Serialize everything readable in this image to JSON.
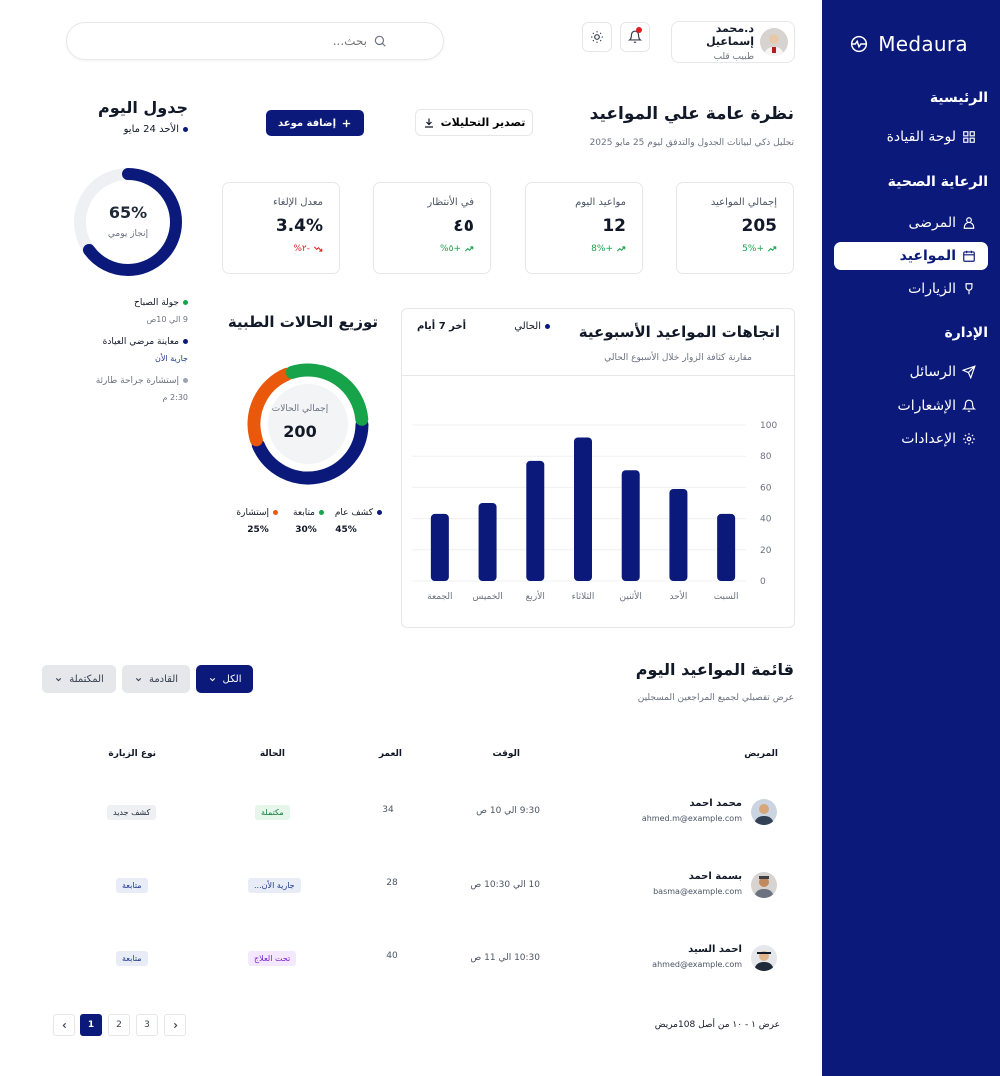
{
  "brand": {
    "name": "Medaura"
  },
  "sidebar": {
    "sections": [
      {
        "title": "الرئيسية",
        "items": [
          {
            "label": "لوحة القيادة",
            "icon": "dashboard-icon"
          }
        ]
      },
      {
        "title": "الرعاية الصحية",
        "items": [
          {
            "label": "المرضى",
            "icon": "patients-icon"
          },
          {
            "label": "المواعيد",
            "icon": "calendar-icon",
            "active": true
          },
          {
            "label": "الزيارات",
            "icon": "visits-icon"
          }
        ]
      },
      {
        "title": "الإدارة",
        "items": [
          {
            "label": "الرسائل",
            "icon": "send-icon"
          },
          {
            "label": "الإشعارات",
            "icon": "bell-icon"
          },
          {
            "label": "الإعدادات",
            "icon": "gear-icon"
          }
        ]
      }
    ]
  },
  "header": {
    "search_placeholder": "بحث...",
    "user_name": "د.محمد إسماعيل",
    "user_role": "طبيب قلب"
  },
  "overview": {
    "title": "نظرة عامة علي المواعيد",
    "subtitle": "تحليل ذكي لبيانات الجدول والتدفق ليوم 25 مايو 2025",
    "export_label": "تصدير التحليلات",
    "add_label": "إضافة موعد"
  },
  "stats": [
    {
      "label": "إجمالي المواعيد",
      "value": "205",
      "change": "+5%",
      "trend": "up"
    },
    {
      "label": "مواعيد اليوم",
      "value": "12",
      "change": "+8%",
      "trend": "up"
    },
    {
      "label": "في الأنتظار",
      "value": "٤٥",
      "change": "+٥%",
      "trend": "up"
    },
    {
      "label": "معدل الإلغاء",
      "value": "3.4%",
      "change": "-٢%",
      "trend": "down"
    }
  ],
  "schedule": {
    "title": "جدول اليوم",
    "date": "الأحد 24 مايو",
    "progress_value": "65%",
    "progress_fraction": 0.65,
    "progress_label": "إنجاز يومي",
    "items": [
      {
        "title": "جولة الصباح",
        "time": "9 الي 10ص",
        "color": "#16a34a"
      },
      {
        "title": "معاينة مرضي العيادة",
        "time": "جارية الأن",
        "color": "#0b1a7a"
      },
      {
        "title": "إستشارة جراحة طارئة",
        "time": "2:30 م",
        "color": "#9ca3af"
      }
    ]
  },
  "distribution": {
    "title": "توزيع الحالات الطبية",
    "center_label": "إجمالي الحالات",
    "center_value": "200",
    "segments": [
      {
        "label": "كشف عام",
        "percent": "45%",
        "value": 45,
        "color": "#0b1a7a"
      },
      {
        "label": "متابعة",
        "percent": "30%",
        "value": 30,
        "color": "#16a34a"
      },
      {
        "label": "إستشارة",
        "percent": "25%",
        "value": 25,
        "color": "#ea580c"
      }
    ]
  },
  "chart_data": {
    "type": "bar",
    "title": "اتجاهات المواعيد الأسبوعية",
    "subtitle": "مقارنة كثافة الزوار خلال الأسبوع الحالي",
    "legend_current": "الحالي",
    "period": "أخر 7 أيام",
    "categories": [
      "السبت",
      "الأحد",
      "الأثنين",
      "الثلاثاء",
      "الأربع",
      "الخميس",
      "الجمعة"
    ],
    "values": [
      43,
      59,
      71,
      92,
      77,
      50,
      43
    ],
    "yticks": [
      "0",
      "20",
      "40",
      "60",
      "80",
      "100"
    ],
    "ylim": [
      0,
      100
    ],
    "color": "#0b1a7a"
  },
  "appointments": {
    "title": "قائمة المواعيد اليوم",
    "subtitle": "عرض تفصيلي لجميع المراجعين المسجلين",
    "filters": [
      {
        "label": "الكل",
        "active": true
      },
      {
        "label": "القادمة"
      },
      {
        "label": "المكتملة"
      }
    ],
    "columns": {
      "patient": "المريض",
      "time": "الوقت",
      "age": "العمر",
      "status": "الحالة",
      "type": "نوع الزيارة"
    },
    "rows": [
      {
        "name": "محمد احمد",
        "email": "ahmed.m@example.com",
        "time": "9:30 الي 10 ص",
        "age": "34",
        "status": "مكتملة",
        "status_style": "green",
        "type": "كشف جديد",
        "type_style": "gray"
      },
      {
        "name": "بسمة احمد",
        "email": "basma@example.com",
        "time": "10 الي 10:30 ص",
        "age": "28",
        "status": "جارية الأن...",
        "status_style": "blue",
        "type": "متابعة",
        "type_style": "blue"
      },
      {
        "name": "احمد السيد",
        "email": "ahmed@example.com",
        "time": "10:30 الي 11 ص",
        "age": "40",
        "status": "تحت العلاج",
        "status_style": "purple",
        "type": "متابعة",
        "type_style": "blue"
      }
    ],
    "pagination_text": "عرض ١ - ١٠ من أصل 108مريض",
    "pages": [
      "1",
      "2",
      "3"
    ]
  }
}
